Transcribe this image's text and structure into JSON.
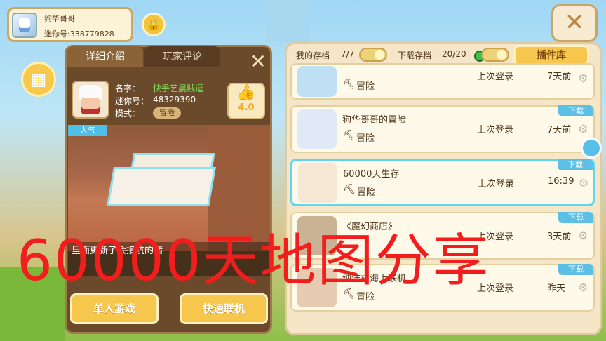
{
  "profile": {
    "name": "狗华哥哥",
    "id_label": "迷你号:338779828"
  },
  "left_panel": {
    "tabs": [
      "详细介绍",
      "玩家评论"
    ],
    "info": {
      "name_label": "名字：",
      "name_value": "快手艺晨贼逗",
      "id_label": "迷你号：",
      "id_value": "48329390",
      "mode_label": "模式：",
      "mode_value": "冒险"
    },
    "rating": "4.0",
    "popular_badge": "人气",
    "description": "里面更新了会接坑的猪",
    "buttons": {
      "single": "单人游戏",
      "multi": "快速联机"
    }
  },
  "right_panel": {
    "my_saves_label": "我的存档",
    "my_saves_count": "7/7",
    "downloads_label": "下载存档",
    "downloads_count": "20/20",
    "plugin_button": "插件库",
    "maps": [
      {
        "title": "",
        "mode": "冒险",
        "login_label": "上次登录",
        "time": "7天前",
        "download_tag": ""
      },
      {
        "title": "狗华哥哥的冒险",
        "mode": "冒险",
        "login_label": "上次登录",
        "time": "7天前",
        "download_tag": "下载"
      },
      {
        "title": "60000天生存",
        "mode": "冒险",
        "login_label": "上次登录",
        "time": "16:39",
        "download_tag": "下载"
      },
      {
        "title": "《魔幻商店》",
        "mode": "",
        "login_label": "上次登录",
        "time": "3天前",
        "download_tag": "下载"
      },
      {
        "title": "纯洁村海上联机",
        "mode": "冒险",
        "login_label": "上次登录",
        "time": "昨天",
        "download_tag": "下载"
      }
    ]
  },
  "overlay_text": "60000天地图分享",
  "colors": {
    "accent_yellow": "#f6c64d",
    "download_blue": "#5bbfe6",
    "overlay_red": "#f21e1e"
  }
}
